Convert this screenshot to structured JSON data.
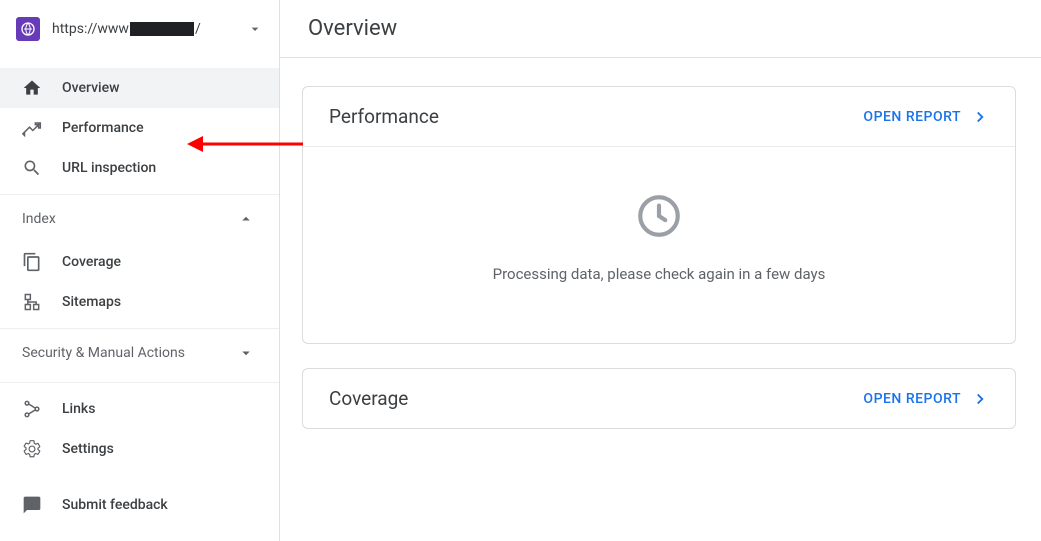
{
  "property": {
    "url_prefix": "https://www",
    "url_suffix": "/"
  },
  "nav": {
    "overview": "Overview",
    "performance": "Performance",
    "url_inspection": "URL inspection",
    "section_index": "Index",
    "coverage": "Coverage",
    "sitemaps": "Sitemaps",
    "section_security": "Security & Manual Actions",
    "links": "Links",
    "settings": "Settings",
    "submit_feedback": "Submit feedback"
  },
  "page": {
    "title": "Overview"
  },
  "cards": {
    "performance": {
      "title": "Performance",
      "open_report": "OPEN REPORT",
      "empty_msg": "Processing data, please check again in a few days"
    },
    "coverage": {
      "title": "Coverage",
      "open_report": "OPEN REPORT"
    }
  }
}
